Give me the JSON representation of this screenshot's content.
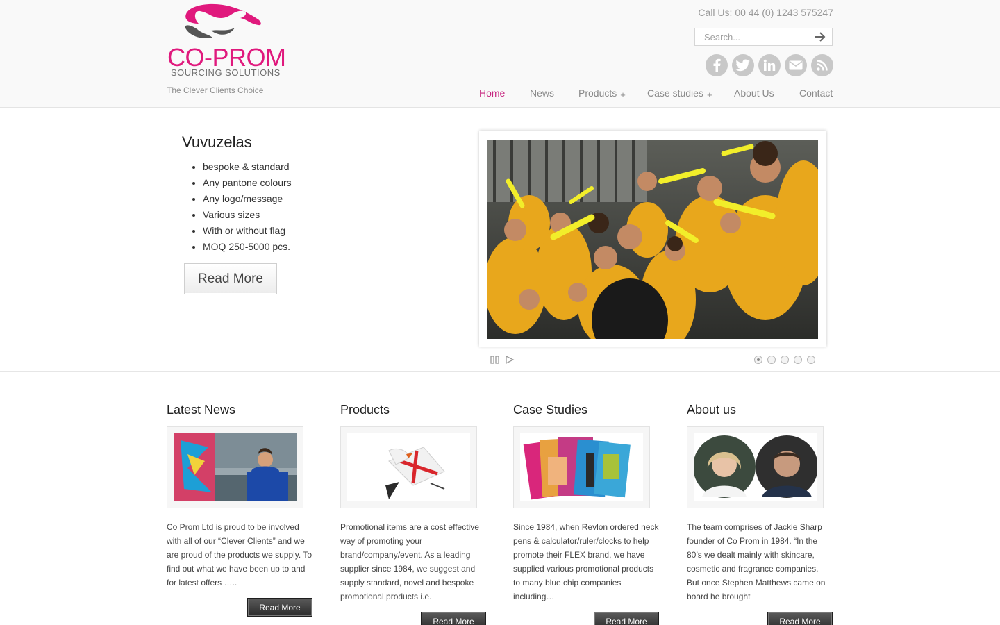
{
  "brand": {
    "name": "CO-PROM",
    "subtitle": "SOURCING SOLUTIONS",
    "tagline": "The Clever Clients Choice",
    "color": "#e0197d"
  },
  "header": {
    "call_us": "Call Us: 00 44 (0) 1243 575247",
    "search_placeholder": "Search..."
  },
  "social": [
    "facebook-icon",
    "twitter-icon",
    "linkedin-icon",
    "email-icon",
    "rss-icon"
  ],
  "nav": {
    "home": "Home",
    "news": "News",
    "products": "Products",
    "case_studies": "Case studies",
    "about": "About Us",
    "contact": "Contact",
    "plus": "+"
  },
  "slider": {
    "title": "Vuvuzelas",
    "bullets": [
      "bespoke & standard",
      "Any pantone colours",
      "Any logo/message",
      "Various sizes",
      "With or without flag",
      "MOQ 250-5000 pcs."
    ],
    "button": "Read More",
    "slide_count": 5,
    "active_slide": 1
  },
  "columns": {
    "news": {
      "title": "Latest News",
      "text": "Co Prom Ltd is proud to be involved with all of our “Clever Clients” and we are proud of the products we supply. To find out what we have been up to and for latest offers …..",
      "button": "Read More"
    },
    "products": {
      "title": "Products",
      "text": "Promotional items are a cost effective way of promoting your brand/company/event. As a leading supplier since 1984, we suggest and supply standard, novel and bespoke promotional products i.e.",
      "button": "Read More"
    },
    "cases": {
      "title": "Case Studies",
      "text": "Since 1984, when Revlon ordered neck pens & calculator/ruler/clocks to help promote their FLEX brand, we have supplied various promotional products to many blue chip companies including…",
      "button": "Read More"
    },
    "about": {
      "title": "About us",
      "text": "The team comprises of Jackie Sharp founder of Co Prom in 1984. “In the 80’s we dealt mainly with skincare, cosmetic and fragrance companies. But once Stephen Matthews came on board he brought",
      "button": "Read More"
    }
  }
}
